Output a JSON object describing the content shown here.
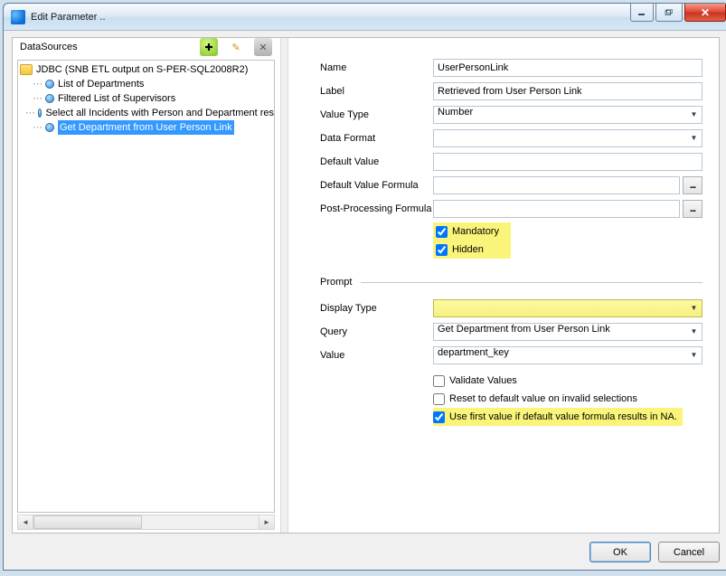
{
  "window": {
    "title": "Edit Parameter .."
  },
  "sidebar": {
    "header": "DataSources",
    "root_label": "JDBC (SNB ETL output on S-PER-SQL2008R2)",
    "items": [
      {
        "label": "List of Departments"
      },
      {
        "label": "Filtered List of Supervisors"
      },
      {
        "label": "Select all Incidents with Person and Department res"
      },
      {
        "label": "Get Department from User Person Link"
      }
    ]
  },
  "form": {
    "name_label": "Name",
    "name_value": "UserPersonLink",
    "label_label": "Label",
    "label_value": "Retrieved from User Person Link",
    "valuetype_label": "Value Type",
    "valuetype_value": "Number",
    "dataformat_label": "Data Format",
    "dataformat_value": "",
    "defaultvalue_label": "Default Value",
    "defaultvalue_value": "",
    "defaultformula_label": "Default Value Formula",
    "defaultformula_value": "",
    "postprocess_label": "Post-Processing Formula",
    "postprocess_value": "",
    "mandatory_label": "Mandatory",
    "hidden_label": "Hidden",
    "prompt_section": "Prompt",
    "displaytype_label": "Display Type",
    "displaytype_value": "",
    "query_label": "Query",
    "query_value": "Get Department from User Person Link",
    "value_label": "Value",
    "value_value": "department_key",
    "validate_label": "Validate Values",
    "reset_label": "Reset to default value on invalid selections",
    "usefirst_label": "Use first value if default value formula results in NA."
  },
  "buttons": {
    "ok": "OK",
    "cancel": "Cancel"
  }
}
